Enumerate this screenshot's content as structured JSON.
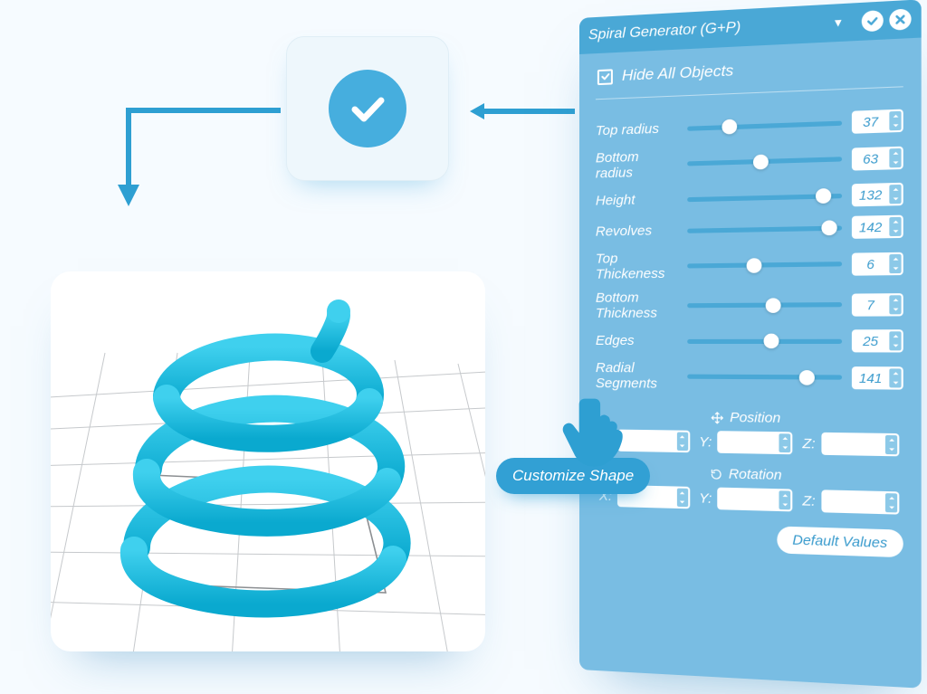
{
  "panel": {
    "title": "Spiral Generator (G+P)",
    "hide_label": "Hide All Objects",
    "hide_checked": true,
    "params": [
      {
        "label": "Top radius",
        "value": 37,
        "pos": 28
      },
      {
        "label": "Bottom radius",
        "value": 63,
        "pos": 48
      },
      {
        "label": "Height",
        "value": 132,
        "pos": 88
      },
      {
        "label": "Revolves",
        "value": 142,
        "pos": 92
      },
      {
        "label": "Top Thickeness",
        "value": 6,
        "pos": 44
      },
      {
        "label": "Bottom Thickness",
        "value": 7,
        "pos": 56
      },
      {
        "label": "Edges",
        "value": 25,
        "pos": 55
      },
      {
        "label": "Radial Segments",
        "value": 141,
        "pos": 78
      }
    ],
    "position_label": "Position",
    "rotation_label": "Rotation",
    "axes": [
      "X:",
      "Y:",
      "Z:"
    ],
    "defaults_label": "Default Values"
  },
  "tooltip": "Customize Shape",
  "colors": {
    "primary": "#46aede",
    "panel_bg": "#79bde3",
    "panel_header": "#4aa8d6",
    "spiral": "#1fc1e1"
  }
}
